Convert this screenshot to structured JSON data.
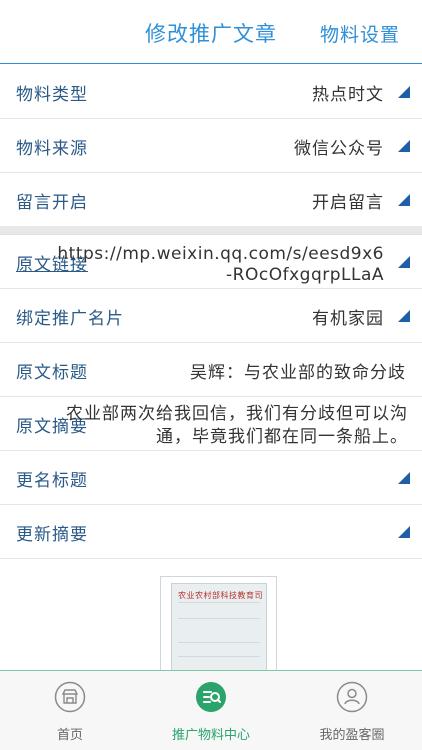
{
  "header": {
    "title": "修改推广文章",
    "settings": "物料设置"
  },
  "rows": {
    "type": {
      "label": "物料类型",
      "value": "热点时文"
    },
    "source": {
      "label": "物料来源",
      "value": "微信公众号"
    },
    "comment": {
      "label": "留言开启",
      "value": "开启留言"
    },
    "link": {
      "label": "原文链接",
      "line1": "https://mp.weixin.qq.com/s/eesd9x6",
      "line2": "-ROcOfxgqrpLLaA"
    },
    "card": {
      "label": "绑定推广名片",
      "value": "有机家园"
    },
    "title": {
      "label": "原文标题",
      "value": "吴辉：与农业部的致命分歧"
    },
    "summary": {
      "label": "原文摘要",
      "line1": "农业部两次给我回信，我们有分歧但可以沟",
      "line2": "通，毕竟我们都在同一条船上。"
    },
    "rename": {
      "label": "更名标题"
    },
    "update": {
      "label": "更新摘要"
    }
  },
  "thumbnail": {
    "heading": "农业农村部科技教育司"
  },
  "tabs": [
    {
      "label": "首页",
      "icon": "shop-icon"
    },
    {
      "label": "推广物料中心",
      "icon": "promo-center-icon",
      "active": true
    },
    {
      "label": "我的盈客圈",
      "icon": "user-icon"
    }
  ],
  "colors": {
    "accent": "#2f8fd8",
    "label": "#2a5a87",
    "arrow": "#1f5ea8",
    "active_tab": "#2aa46a"
  }
}
